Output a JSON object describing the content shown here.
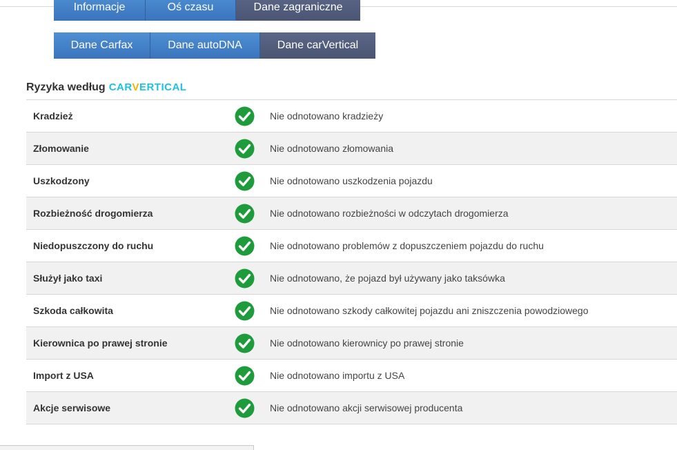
{
  "tabs_row1": [
    {
      "label": "Informacje",
      "active": false
    },
    {
      "label": "Oś czasu",
      "active": false
    },
    {
      "label": "Dane zagraniczne",
      "active": true
    }
  ],
  "tabs_row2": [
    {
      "label": "Dane Carfax",
      "active": false
    },
    {
      "label": "Dane autoDNA",
      "active": false
    },
    {
      "label": "Dane carVertical",
      "active": true
    }
  ],
  "section": {
    "title": "Ryzyka według",
    "brand_part1": "CAR",
    "brand_v": "V",
    "brand_part2": "ERTICAL"
  },
  "colors": {
    "tab_blue": "#3a74bd",
    "tab_active": "#4a5473",
    "check_green": "#1e9b3b",
    "brand_cyan": "#1cc3e2",
    "brand_yellow": "#f5b400"
  },
  "status_icon": "check-circle-icon",
  "risks": [
    {
      "label": "Kradzież",
      "desc": "Nie odnotowano kradzieży"
    },
    {
      "label": "Złomowanie",
      "desc": "Nie odnotowano złomowania"
    },
    {
      "label": "Uszkodzony",
      "desc": "Nie odnotowano uszkodzenia pojazdu"
    },
    {
      "label": "Rozbieżność drogomierza",
      "desc": "Nie odnotowano rozbieżności w odczytach drogomierza"
    },
    {
      "label": "Niedopuszczony do ruchu",
      "desc": "Nie odnotowano problemów z dopuszczeniem pojazdu do ruchu"
    },
    {
      "label": "Służył jako taxi",
      "desc": "Nie odnotowano, że pojazd był używany jako taksówka"
    },
    {
      "label": "Szkoda całkowita",
      "desc": "Nie odnotowano szkody całkowitej pojazdu ani zniszczenia powodziowego"
    },
    {
      "label": "Kierownica po prawej stronie",
      "desc": "Nie odnotowano kierownicy po prawej stronie"
    },
    {
      "label": "Import z USA",
      "desc": "Nie odnotowano importu z USA"
    },
    {
      "label": "Akcje serwisowe",
      "desc": "Nie odnotowano akcji serwisowej producenta"
    }
  ]
}
